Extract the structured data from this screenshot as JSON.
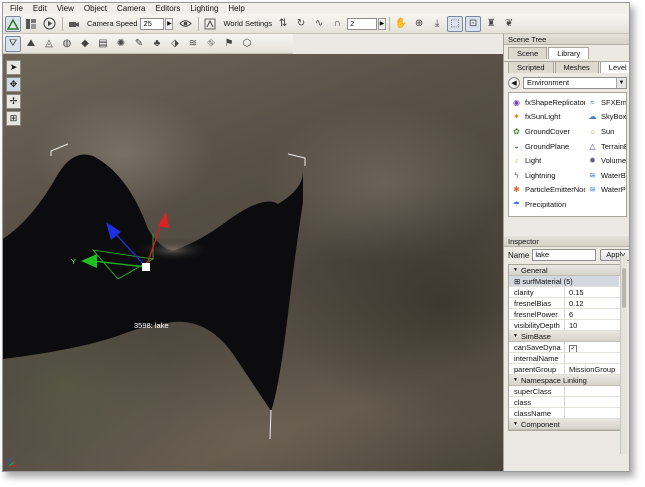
{
  "menu": [
    "File",
    "Edit",
    "View",
    "Object",
    "Camera",
    "Editors",
    "Lighting",
    "Help"
  ],
  "toolbar": {
    "camera_speed_label": "Camera Speed",
    "camera_speed_value": "25",
    "world_settings_label": "World Settings",
    "snap_value": "2"
  },
  "viewport": {
    "object_label": "3598: lake",
    "axis_y_label": "Y"
  },
  "scene_tree": {
    "title": "Scene Tree",
    "tabs": [
      "Scene",
      "Library"
    ],
    "active_tab": "Library",
    "subtabs": [
      "Scripted",
      "Meshes",
      "Level"
    ],
    "active_subtab": "Level",
    "category": "Environment",
    "items": [
      {
        "label": "fxShapeReplicator",
        "icon": "replicator-icon",
        "color": "#7a3fa8"
      },
      {
        "label": "SFXEmitter",
        "icon": "sfx-emitter-icon",
        "color": "#3a6ea8"
      },
      {
        "label": "fxSunLight",
        "icon": "sunlight-icon",
        "color": "#e07a10"
      },
      {
        "label": "SkyBox",
        "icon": "skybox-icon",
        "color": "#3a78c8"
      },
      {
        "label": "GroundCover",
        "icon": "groundcover-icon",
        "color": "#3f8a2a"
      },
      {
        "label": "Sun",
        "icon": "sun-icon",
        "color": "#e0a010"
      },
      {
        "label": "GroundPlane",
        "icon": "groundplane-icon",
        "color": "#4a9a3a"
      },
      {
        "label": "TerrainBlock",
        "icon": "terrain-icon",
        "color": "#5a4aa8"
      },
      {
        "label": "Light",
        "icon": "light-icon",
        "color": "#e0b020"
      },
      {
        "label": "VolumeLight",
        "icon": "volumelight-icon",
        "color": "#5a5a8a"
      },
      {
        "label": "Lightning",
        "icon": "lightning-icon",
        "color": "#5a6ac8"
      },
      {
        "label": "WaterBlock",
        "icon": "waterblock-icon",
        "color": "#3a88d8"
      },
      {
        "label": "ParticleEmitterNode",
        "icon": "particle-icon",
        "color": "#d86a2a"
      },
      {
        "label": "WaterPlane",
        "icon": "waterplane-icon",
        "color": "#3a88d8"
      },
      {
        "label": "Precipitation",
        "icon": "precipitation-icon",
        "color": "#3a78c8"
      }
    ]
  },
  "inspector": {
    "title": "Inspector",
    "name_label": "Name",
    "name_value": "lake",
    "apply_label": "Apply",
    "sections": [
      {
        "title": "General",
        "rows": [
          {
            "key": "surfMaterial (5)",
            "value": "",
            "type": "expander"
          },
          {
            "key": "clarity",
            "value": "0.15"
          },
          {
            "key": "fresnelBias",
            "value": "0.12"
          },
          {
            "key": "fresnelPower",
            "value": "6"
          },
          {
            "key": "visibilityDepth",
            "value": "10"
          }
        ]
      },
      {
        "title": "SimBase",
        "rows": [
          {
            "key": "canSaveDyna",
            "value": "",
            "type": "checkbox",
            "checked": true
          },
          {
            "key": "internalName",
            "value": ""
          },
          {
            "key": "parentGroup",
            "value": "MissionGroup"
          }
        ]
      },
      {
        "title": "Namespace Linking",
        "rows": [
          {
            "key": "superClass",
            "value": ""
          },
          {
            "key": "class",
            "value": ""
          },
          {
            "key": "className",
            "value": ""
          }
        ]
      },
      {
        "title": "Component",
        "rows": []
      }
    ]
  }
}
